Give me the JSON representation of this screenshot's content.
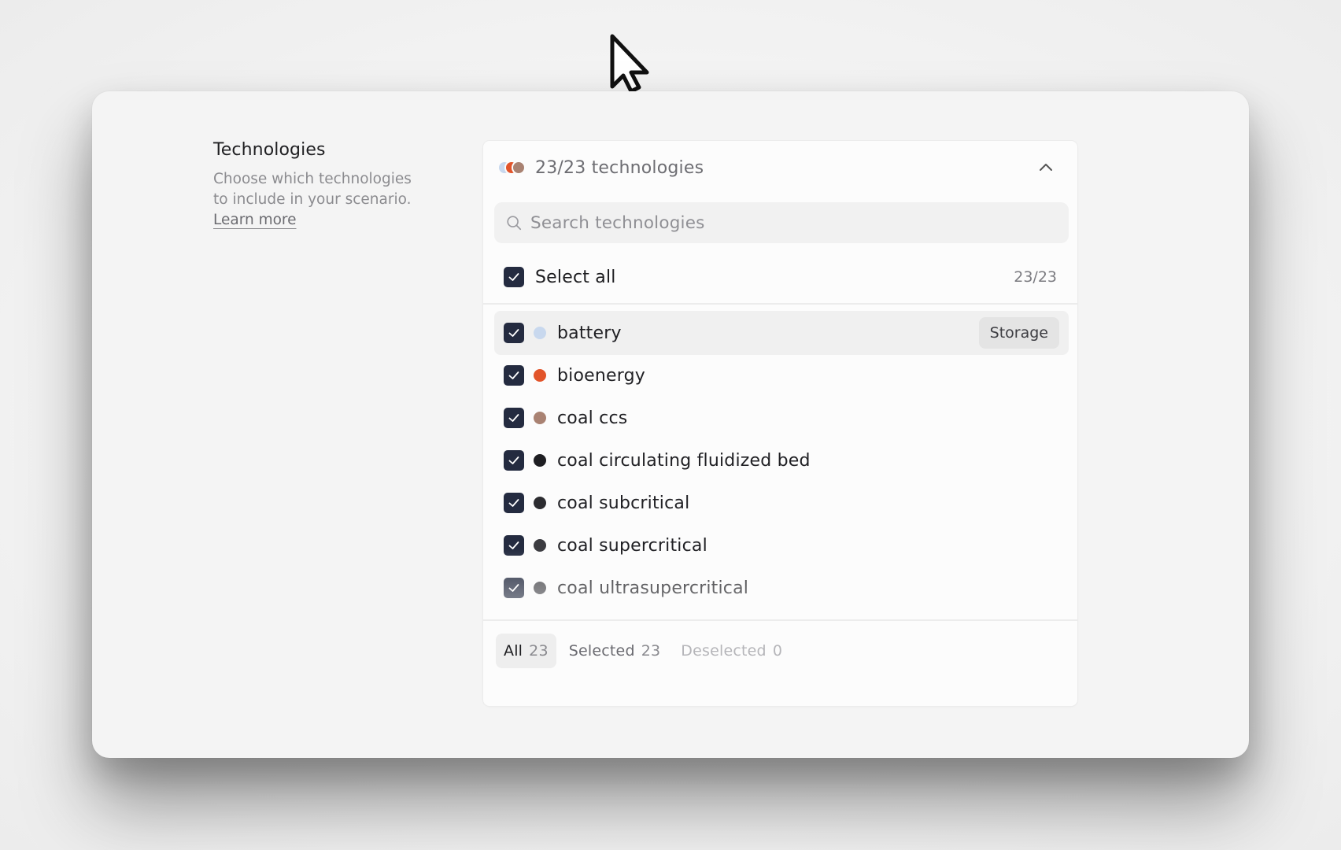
{
  "info": {
    "title": "Technologies",
    "description": "Choose which technologies to include in your scenario.",
    "learn_more": "Learn more"
  },
  "dropdown": {
    "summary": "23/23 technologies",
    "summary_dot_colors": [
      "#c8d8ee",
      "#e2542a",
      "#a98272"
    ],
    "expanded": true
  },
  "search": {
    "placeholder": "Search technologies",
    "value": ""
  },
  "select_all": {
    "label": "Select all",
    "count": "23/23",
    "checked": true
  },
  "items": [
    {
      "label": "battery",
      "color": "#c8d8ee",
      "checked": true,
      "tag": "Storage"
    },
    {
      "label": "bioenergy",
      "color": "#e2542a",
      "checked": true,
      "tag": ""
    },
    {
      "label": "coal ccs",
      "color": "#a98272",
      "checked": true,
      "tag": ""
    },
    {
      "label": "coal circulating fluidized bed",
      "color": "#1e1e22",
      "checked": true,
      "tag": ""
    },
    {
      "label": "coal subcritical",
      "color": "#2c2c30",
      "checked": true,
      "tag": ""
    },
    {
      "label": "coal supercritical",
      "color": "#3b3b40",
      "checked": true,
      "tag": ""
    },
    {
      "label": "coal ultrasupercritical",
      "color": "#4a4a4f",
      "checked": true,
      "tag": ""
    }
  ],
  "tabs": [
    {
      "label": "All",
      "count": "23",
      "active": true
    },
    {
      "label": "Selected",
      "count": "23",
      "active": false
    },
    {
      "label": "Deselected",
      "count": "0",
      "active": false
    }
  ]
}
